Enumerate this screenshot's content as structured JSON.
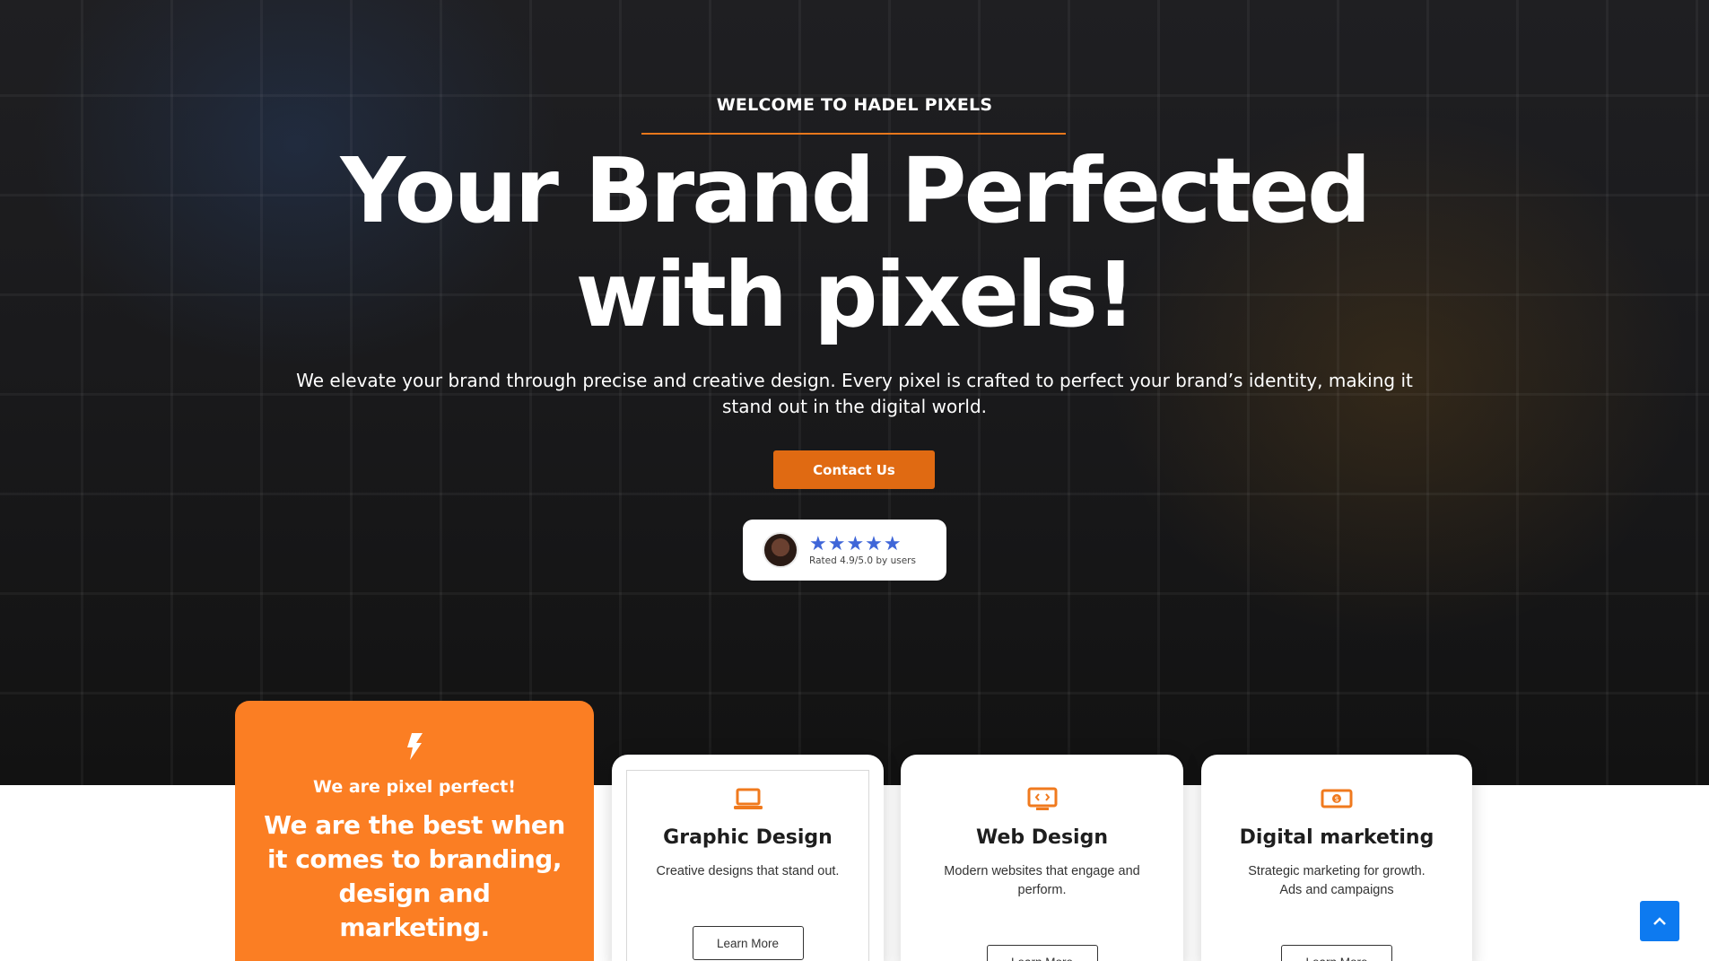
{
  "hero": {
    "eyebrow": "WELCOME TO HADEL PIXELS",
    "headline_line1": "Your Brand Perfected",
    "headline_line2": "with pixels!",
    "lead": "We elevate your brand through precise and creative design. Every pixel is crafted to perfect your brand’s identity, making it stand out in the digital world.",
    "contact_label": "Contact Us",
    "rating": {
      "stars": "★★★★★",
      "text": "Rated 4.9/5.0 by users",
      "star_count": 5,
      "star_color": "#3f66d8"
    }
  },
  "highlight_card": {
    "icon": "bolt-icon",
    "subtitle": "We are pixel perfect!",
    "title": "We are the best when it comes to branding, design and marketing.",
    "color": "#fb7e23"
  },
  "services": [
    {
      "icon": "laptop-icon",
      "title": "Graphic Design",
      "description": "Creative designs that stand out.",
      "button": "Learn More"
    },
    {
      "icon": "code-monitor-icon",
      "title": "Web Design",
      "description": "Modern websites that engage and perform.",
      "button": "Learn More"
    },
    {
      "icon": "money-icon",
      "title": "Digital marketing",
      "description": "Strategic marketing for growth. Ads and campaigns",
      "button": "Learn More"
    }
  ],
  "colors": {
    "accent": "#e06a12",
    "scroll_button": "#0d7af0"
  },
  "scroll_top_icon": "chevron-up-icon"
}
